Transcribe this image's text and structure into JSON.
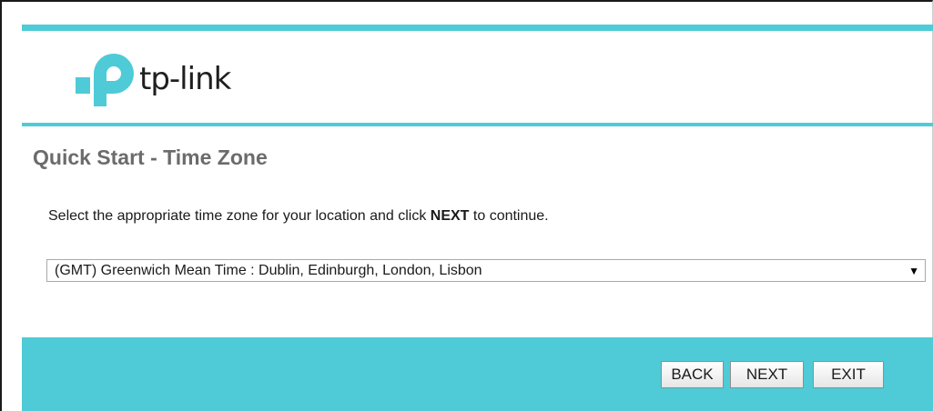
{
  "brand": {
    "logo_text": "tp-link",
    "accent_color": "#4ecbd6"
  },
  "page": {
    "title": "Quick Start - Time Zone",
    "instruction_before": "Select the appropriate time zone for your location and click ",
    "instruction_emphasis": "NEXT",
    "instruction_after": " to continue."
  },
  "timezone_select": {
    "selected_value": "(GMT) Greenwich Mean Time : Dublin, Edinburgh, London, Lisbon",
    "arrow_icon": "dropdown-arrow-icon",
    "arrow_glyph": "▼"
  },
  "buttons": {
    "back_label": "BACK",
    "next_label": "NEXT",
    "exit_label": "EXIT"
  }
}
